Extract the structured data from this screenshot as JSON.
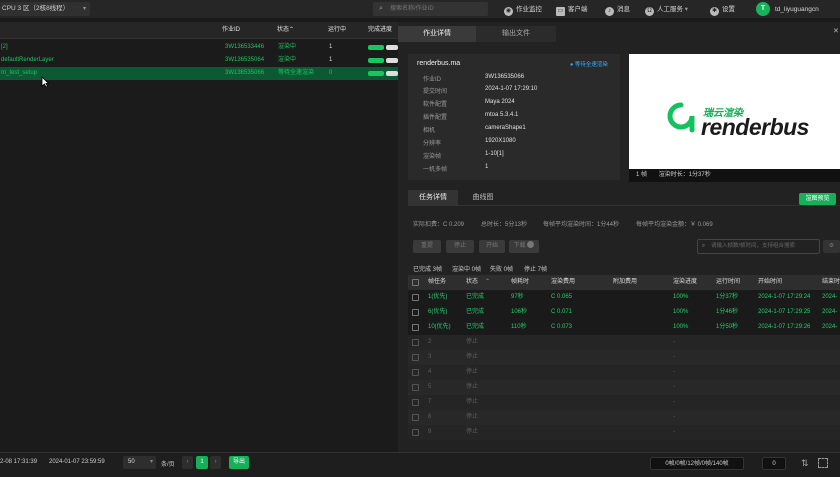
{
  "topbar": {
    "region": "CPU 3 区（2核8线程）",
    "search_placeholder": "搜索名称/作业ID",
    "nav": [
      "作业监控",
      "客户端",
      "消息",
      "人工服务",
      "设置"
    ],
    "avatar_letter": "T",
    "username": "td_liyuguangcn"
  },
  "job_table": {
    "headers": [
      "作业ID",
      "状态",
      "运行中",
      "完成进度"
    ],
    "rows": [
      {
        "name": "[2]",
        "id": "3W136533446",
        "status": "渲染中",
        "running": "1",
        "progress": 0.55
      },
      {
        "name": "defaultRenderLayer",
        "id": "3W136535064",
        "status": "渲染中",
        "running": "1",
        "progress": 0.55
      },
      {
        "name": "m_test_setup",
        "id": "3W136535066",
        "status": "等待全速渲染",
        "running": "0",
        "progress": 0.55
      }
    ]
  },
  "detail_tabs": [
    "作业详情",
    "输出文件"
  ],
  "detail": {
    "file_name": "renderbus.ma",
    "wait_label": "● 等待全速渲染",
    "fields": [
      {
        "k": "作业ID",
        "v": "3W136535066"
      },
      {
        "k": "提交时间",
        "v": "2024-1-07 17:29:10"
      },
      {
        "k": "软件配置",
        "v": "Maya 2024"
      },
      {
        "k": "插件配置",
        "v": "mtoa 5.3.4.1"
      },
      {
        "k": "相机",
        "v": "cameraShape1"
      },
      {
        "k": "分辨率",
        "v": "1920X1080"
      },
      {
        "k": "渲染帧",
        "v": "1-10[1]"
      },
      {
        "k": "一机多帧",
        "v": "1"
      }
    ]
  },
  "preview": {
    "logo_cn": "瑞云渲染",
    "logo_en": "renderbus",
    "caption_frame": "1 帧",
    "caption_time": "渲染时长：1分37秒"
  },
  "task_tabs": [
    "任务详情",
    "曲线图"
  ],
  "task_action": "渲图预览",
  "stats": {
    "actual_cost": "实际扣费：C 0.209",
    "total_time": "总时长：5分13秒",
    "avg_time": "每帧平均渲染时间：1分44秒",
    "avg_cost": "每帧平均渲染金额：￥ 0.069"
  },
  "task_buttons": [
    "重提",
    "停止",
    "开始",
    "下载"
  ],
  "task_search_placeholder": "请输入帧数/帧时间，支持组合搜索",
  "summary": [
    "已完成 3帧",
    "渲染中 0帧",
    "失败 0帧",
    "停止 7帧"
  ],
  "frame_headers": [
    "帧任务",
    "状态",
    "帧耗时",
    "渲染费用",
    "附加费用",
    "渲染进度",
    "运行时间",
    "开始时间",
    "结束时"
  ],
  "frames": [
    {
      "task": "1(优先)",
      "status": "已完成",
      "time": "97秒",
      "cost": "C 0.065",
      "extra": "",
      "progress": "100%",
      "run": "1分37秒",
      "start": "2024-1-07 17:29:24",
      "end": "2024-1-"
    },
    {
      "task": "6(优先)",
      "status": "已完成",
      "time": "106秒",
      "cost": "C 0.071",
      "extra": "",
      "progress": "100%",
      "run": "1分46秒",
      "start": "2024-1-07 17:29:25",
      "end": "2024-1-"
    },
    {
      "task": "10(优先)",
      "status": "已完成",
      "time": "110秒",
      "cost": "C 0.073",
      "extra": "",
      "progress": "100%",
      "run": "1分50秒",
      "start": "2024-1-07 17:29:26",
      "end": "2024-1-"
    },
    {
      "task": "2",
      "status": "停止",
      "time": "",
      "cost": "-",
      "extra": "",
      "progress": "",
      "run": "",
      "start": "",
      "end": ""
    },
    {
      "task": "3",
      "status": "停止",
      "time": "",
      "cost": "-",
      "extra": "",
      "progress": "",
      "run": "",
      "start": "",
      "end": ""
    },
    {
      "task": "4",
      "status": "停止",
      "time": "",
      "cost": "-",
      "extra": "",
      "progress": "",
      "run": "",
      "start": "",
      "end": ""
    },
    {
      "task": "5",
      "status": "停止",
      "time": "",
      "cost": "-",
      "extra": "",
      "progress": "",
      "run": "",
      "start": "",
      "end": ""
    },
    {
      "task": "7",
      "status": "停止",
      "time": "",
      "cost": "-",
      "extra": "",
      "progress": "",
      "run": "",
      "start": "",
      "end": ""
    },
    {
      "task": "8",
      "status": "停止",
      "time": "",
      "cost": "-",
      "extra": "",
      "progress": "",
      "run": "",
      "start": "",
      "end": ""
    },
    {
      "task": "9",
      "status": "停止",
      "time": "",
      "cost": "-",
      "extra": "",
      "progress": "",
      "run": "",
      "start": "",
      "end": ""
    }
  ],
  "bottom": {
    "date_from": "2-08 17:31:39",
    "date_to": "2024-01-07 23:59:59",
    "page_size": "50",
    "per_page": "条/页",
    "page": "1",
    "export": "导出",
    "counts": "0帧/0帧/12帧/0帧/140帧",
    "zero": "0"
  }
}
